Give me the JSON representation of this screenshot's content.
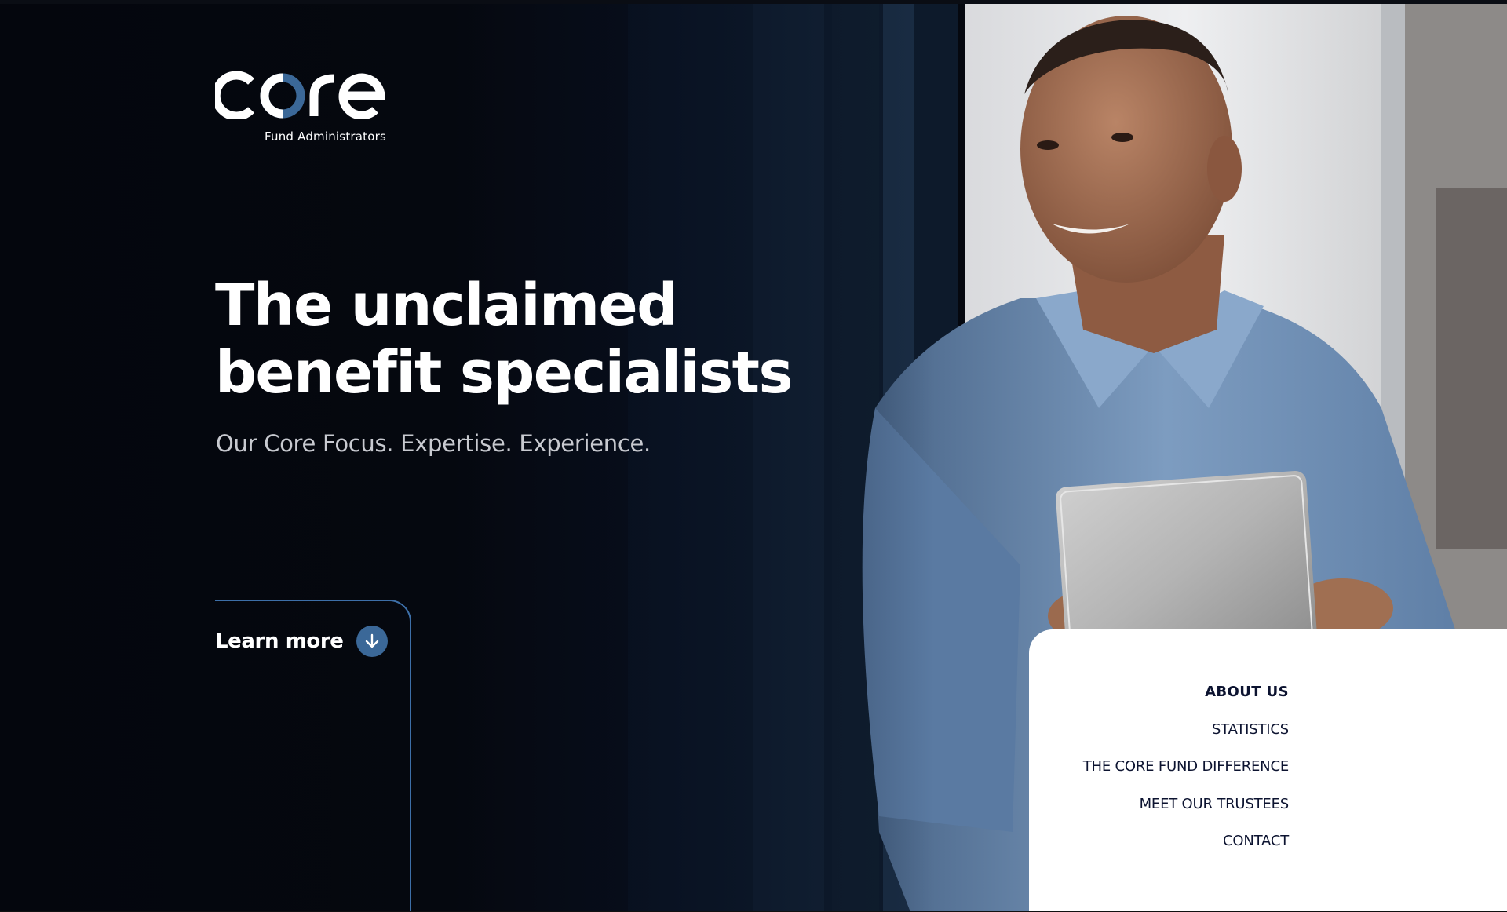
{
  "brand": {
    "wordmark": "core",
    "tagline": "Fund Administrators",
    "accent_color": "#3b6898",
    "text_color": "#ffffff"
  },
  "hero": {
    "headline_lines": [
      "The unclaimed",
      "benefit specialists"
    ],
    "subheadline": "Our Core Focus. Expertise. Experience.",
    "cta": {
      "label": "Learn more",
      "icon": "arrow-down-icon"
    },
    "photo": "smiling man in blue shirt holding a tablet by a window"
  },
  "nav": {
    "items": [
      {
        "label": "ABOUT US",
        "active": true
      },
      {
        "label": "STATISTICS",
        "active": false
      },
      {
        "label": "THE CORE FUND DIFFERENCE",
        "active": false
      },
      {
        "label": "MEET OUR TRUSTEES",
        "active": false
      },
      {
        "label": "CONTACT",
        "active": false
      }
    ],
    "text_color": "#0c1330"
  }
}
